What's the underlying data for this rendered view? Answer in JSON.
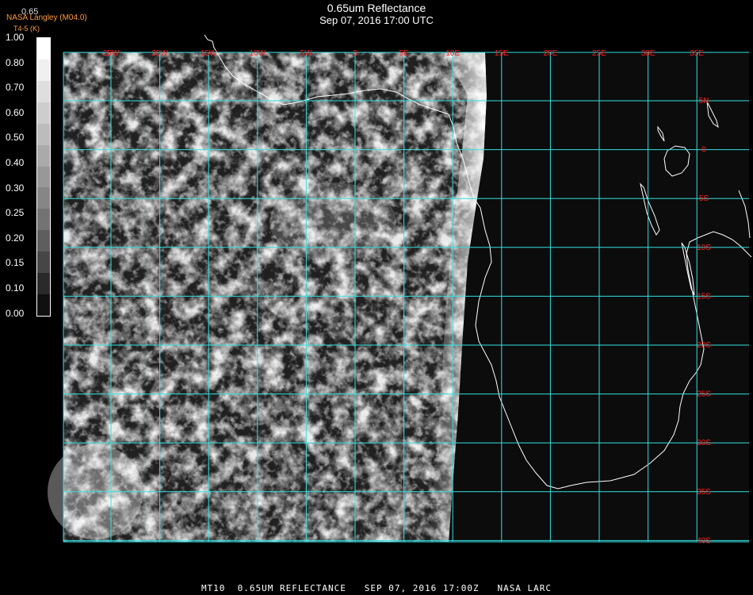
{
  "header": {
    "title": "0.65um Reflectance",
    "datetime": "Sep 07, 2016 17:00 UTC",
    "credit": "NASA Langley (M04.0)",
    "credit_sub": "T4-5 (K)",
    "overlap_label": "0.65"
  },
  "colorbar": {
    "labels": [
      "1.00",
      "0.80",
      "0.70",
      "0.60",
      "0.50",
      "0.40",
      "0.30",
      "0.25",
      "0.20",
      "0.15",
      "0.10",
      "0.00"
    ],
    "colors": [
      "#ffffff",
      "#f0f0f0",
      "#dedede",
      "#cdcdcd",
      "#bcbcbc",
      "#aaaaaa",
      "#989898",
      "#868686",
      "#737373",
      "#5e5e5e",
      "#464646",
      "#2a2a2a",
      "#101010"
    ]
  },
  "map": {
    "grid_color": "#33e0e0",
    "label_color": "#ff2020",
    "coast_color": "#ffffff",
    "lon_labels": [
      "25W",
      "20W",
      "15W",
      "10W",
      "5W",
      "0",
      "5E",
      "10E",
      "15E",
      "20E",
      "25E",
      "30E",
      "35E"
    ],
    "lat_labels": [
      "5N",
      "0",
      "5S",
      "10S",
      "15S",
      "20S",
      "25S",
      "30S",
      "35S",
      "40S"
    ]
  },
  "footer": {
    "text": "MT10  0.65UM REFLECTANCE   SEP 07, 2016 17:00Z   NASA LARC"
  }
}
